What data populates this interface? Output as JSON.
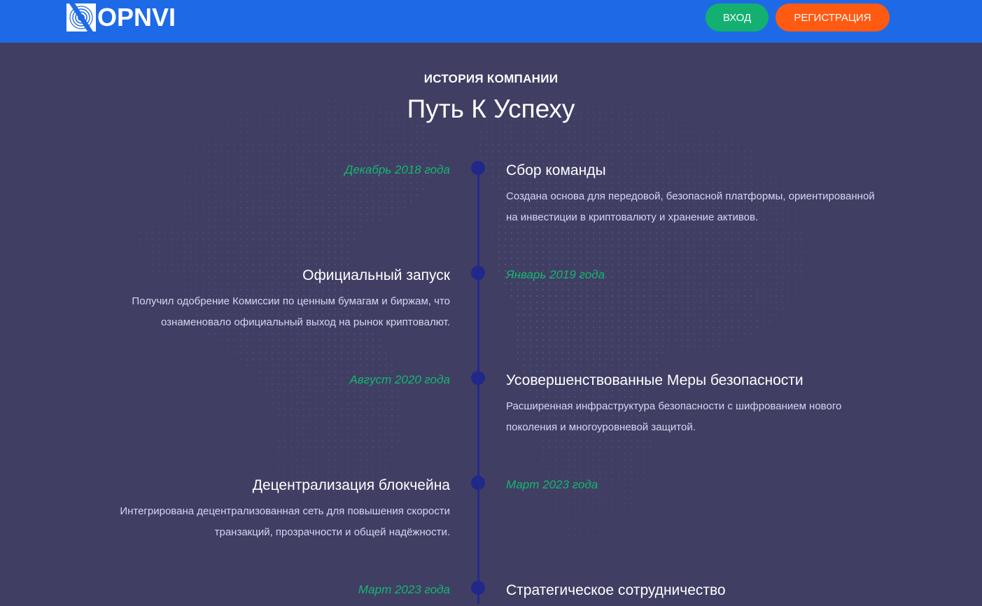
{
  "header": {
    "logo_text": "OPNVI",
    "login_label": "ВХОД",
    "register_label": "РЕГИСТРАЦИЯ",
    "colors": {
      "bar": "#1e6ae6",
      "login": "#13b072",
      "register": "#ff5a12"
    }
  },
  "section": {
    "eyebrow": "ИСТОРИЯ КОМПАНИИ",
    "title": "Путь К Успеху"
  },
  "timeline": [
    {
      "date": "Декабрь 2018 года",
      "title": "Сбор команды",
      "description": "Создана основа для передовой, безопасной платформы, ориентированной на инвестиции в криптовалюту и хранение активов.",
      "side": "right"
    },
    {
      "date": "Январь 2019 года",
      "title": "Официальный запуск",
      "description": "Получил одобрение Комиссии по ценным бумагам и биржам, что ознаменовало официальный выход на рынок криптовалют.",
      "side": "left"
    },
    {
      "date": "Август 2020 года",
      "title": "Усовершенствованные Меры безопасности",
      "description": "Расширенная инфраструктура безопасности с шифрованием нового поколения и многоуровневой защитой.",
      "side": "right"
    },
    {
      "date": "Март 2023 года",
      "title": "Децентрализация блокчейна",
      "description": "Интегрирована децентрализованная сеть для повышения скорости транзакций, прозрачности и общей надёжности.",
      "side": "left"
    },
    {
      "date": "Март 2023 года",
      "title": "Стратегическое сотрудничество",
      "description": "",
      "side": "right"
    }
  ],
  "colors": {
    "background": "#413e63",
    "accent_date": "#13b76f",
    "timeline": "#20288a"
  }
}
